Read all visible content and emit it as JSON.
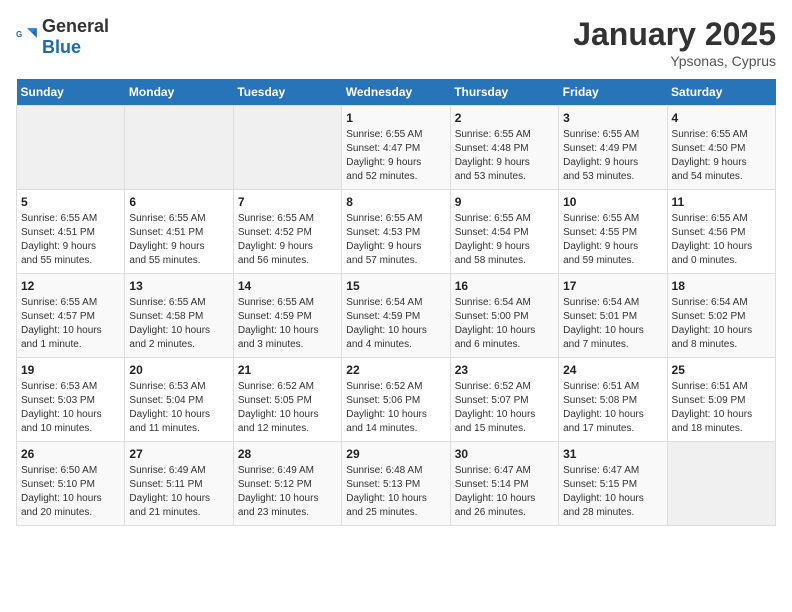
{
  "header": {
    "logo_general": "General",
    "logo_blue": "Blue",
    "title": "January 2025",
    "subtitle": "Ypsonas, Cyprus"
  },
  "days_of_week": [
    "Sunday",
    "Monday",
    "Tuesday",
    "Wednesday",
    "Thursday",
    "Friday",
    "Saturday"
  ],
  "weeks": [
    [
      {
        "day": "",
        "info": ""
      },
      {
        "day": "",
        "info": ""
      },
      {
        "day": "",
        "info": ""
      },
      {
        "day": "1",
        "info": "Sunrise: 6:55 AM\nSunset: 4:47 PM\nDaylight: 9 hours\nand 52 minutes."
      },
      {
        "day": "2",
        "info": "Sunrise: 6:55 AM\nSunset: 4:48 PM\nDaylight: 9 hours\nand 53 minutes."
      },
      {
        "day": "3",
        "info": "Sunrise: 6:55 AM\nSunset: 4:49 PM\nDaylight: 9 hours\nand 53 minutes."
      },
      {
        "day": "4",
        "info": "Sunrise: 6:55 AM\nSunset: 4:50 PM\nDaylight: 9 hours\nand 54 minutes."
      }
    ],
    [
      {
        "day": "5",
        "info": "Sunrise: 6:55 AM\nSunset: 4:51 PM\nDaylight: 9 hours\nand 55 minutes."
      },
      {
        "day": "6",
        "info": "Sunrise: 6:55 AM\nSunset: 4:51 PM\nDaylight: 9 hours\nand 55 minutes."
      },
      {
        "day": "7",
        "info": "Sunrise: 6:55 AM\nSunset: 4:52 PM\nDaylight: 9 hours\nand 56 minutes."
      },
      {
        "day": "8",
        "info": "Sunrise: 6:55 AM\nSunset: 4:53 PM\nDaylight: 9 hours\nand 57 minutes."
      },
      {
        "day": "9",
        "info": "Sunrise: 6:55 AM\nSunset: 4:54 PM\nDaylight: 9 hours\nand 58 minutes."
      },
      {
        "day": "10",
        "info": "Sunrise: 6:55 AM\nSunset: 4:55 PM\nDaylight: 9 hours\nand 59 minutes."
      },
      {
        "day": "11",
        "info": "Sunrise: 6:55 AM\nSunset: 4:56 PM\nDaylight: 10 hours\nand 0 minutes."
      }
    ],
    [
      {
        "day": "12",
        "info": "Sunrise: 6:55 AM\nSunset: 4:57 PM\nDaylight: 10 hours\nand 1 minute."
      },
      {
        "day": "13",
        "info": "Sunrise: 6:55 AM\nSunset: 4:58 PM\nDaylight: 10 hours\nand 2 minutes."
      },
      {
        "day": "14",
        "info": "Sunrise: 6:55 AM\nSunset: 4:59 PM\nDaylight: 10 hours\nand 3 minutes."
      },
      {
        "day": "15",
        "info": "Sunrise: 6:54 AM\nSunset: 4:59 PM\nDaylight: 10 hours\nand 4 minutes."
      },
      {
        "day": "16",
        "info": "Sunrise: 6:54 AM\nSunset: 5:00 PM\nDaylight: 10 hours\nand 6 minutes."
      },
      {
        "day": "17",
        "info": "Sunrise: 6:54 AM\nSunset: 5:01 PM\nDaylight: 10 hours\nand 7 minutes."
      },
      {
        "day": "18",
        "info": "Sunrise: 6:54 AM\nSunset: 5:02 PM\nDaylight: 10 hours\nand 8 minutes."
      }
    ],
    [
      {
        "day": "19",
        "info": "Sunrise: 6:53 AM\nSunset: 5:03 PM\nDaylight: 10 hours\nand 10 minutes."
      },
      {
        "day": "20",
        "info": "Sunrise: 6:53 AM\nSunset: 5:04 PM\nDaylight: 10 hours\nand 11 minutes."
      },
      {
        "day": "21",
        "info": "Sunrise: 6:52 AM\nSunset: 5:05 PM\nDaylight: 10 hours\nand 12 minutes."
      },
      {
        "day": "22",
        "info": "Sunrise: 6:52 AM\nSunset: 5:06 PM\nDaylight: 10 hours\nand 14 minutes."
      },
      {
        "day": "23",
        "info": "Sunrise: 6:52 AM\nSunset: 5:07 PM\nDaylight: 10 hours\nand 15 minutes."
      },
      {
        "day": "24",
        "info": "Sunrise: 6:51 AM\nSunset: 5:08 PM\nDaylight: 10 hours\nand 17 minutes."
      },
      {
        "day": "25",
        "info": "Sunrise: 6:51 AM\nSunset: 5:09 PM\nDaylight: 10 hours\nand 18 minutes."
      }
    ],
    [
      {
        "day": "26",
        "info": "Sunrise: 6:50 AM\nSunset: 5:10 PM\nDaylight: 10 hours\nand 20 minutes."
      },
      {
        "day": "27",
        "info": "Sunrise: 6:49 AM\nSunset: 5:11 PM\nDaylight: 10 hours\nand 21 minutes."
      },
      {
        "day": "28",
        "info": "Sunrise: 6:49 AM\nSunset: 5:12 PM\nDaylight: 10 hours\nand 23 minutes."
      },
      {
        "day": "29",
        "info": "Sunrise: 6:48 AM\nSunset: 5:13 PM\nDaylight: 10 hours\nand 25 minutes."
      },
      {
        "day": "30",
        "info": "Sunrise: 6:47 AM\nSunset: 5:14 PM\nDaylight: 10 hours\nand 26 minutes."
      },
      {
        "day": "31",
        "info": "Sunrise: 6:47 AM\nSunset: 5:15 PM\nDaylight: 10 hours\nand 28 minutes."
      },
      {
        "day": "",
        "info": ""
      }
    ]
  ]
}
